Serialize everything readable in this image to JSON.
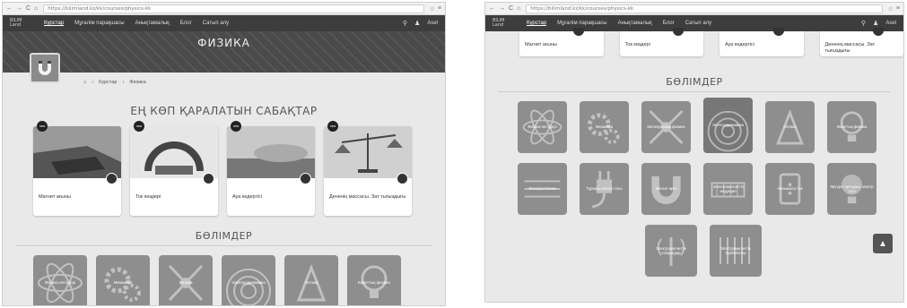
{
  "browser": {
    "url": "https://bilimland.kz/kk/courses/physics-kk"
  },
  "site": {
    "logo_line1": "BILIM",
    "logo_line2": "Land",
    "menu": [
      "Курстар",
      "Мұғалім парақшасы",
      "Анықтамалық",
      "Блог",
      "Сатып алу"
    ],
    "user": "Asel"
  },
  "hero": {
    "title": "ФИЗИКА"
  },
  "breadcrumb": {
    "items": [
      "Курстар",
      "Физика"
    ]
  },
  "popular": {
    "title": "ЕҢ КӨП ҚАРАЛАТЫН САБАҚТАР",
    "new_badge": "new",
    "lessons": [
      "Магнит ағыны",
      "Ток көздері",
      "Ауа кедергісі",
      "Дененің массасы. Зат тығыздығы"
    ]
  },
  "sections": {
    "title": "БӨЛІМДЕР",
    "left_items": [
      "Физика негіздері",
      "Механика",
      "Физика",
      "Электродинамика",
      "Оптика",
      "Кванттық физика"
    ],
    "right_row1": [
      "Физика негіздері",
      "Механика",
      "Молекулалық физика",
      "Электродинамика",
      "Оптика",
      "Кванттық физика"
    ],
    "right_row2": [
      "Электростатика",
      "Тұрақты электр тогы",
      "Магнит өрісі",
      "Электромагниттік индукция",
      "Айнымалы ток",
      "Әртүрлі ортадағы электр тогы"
    ],
    "right_row3": [
      "Электромагниттік толқындар",
      "Электромагниттік тербелістер"
    ]
  },
  "right_top": {
    "lessons": [
      "Магнит ағыны",
      "Ток көздері",
      "Ауа кедергісі",
      "Дененің массасы. Зат тығыздығы"
    ]
  },
  "colors": {
    "nav_bg": "#3d3d3d",
    "tile_bg": "#8e8e8e",
    "page_bg": "#e9e9e9"
  }
}
